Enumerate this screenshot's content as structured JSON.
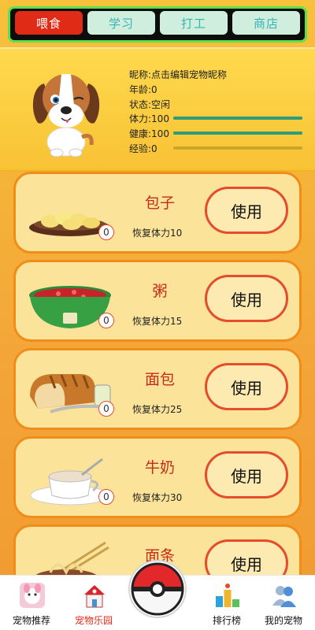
{
  "tabs": [
    {
      "label": "喂食",
      "active": true
    },
    {
      "label": "学习",
      "active": false
    },
    {
      "label": "打工",
      "active": false
    },
    {
      "label": "商店",
      "active": false
    }
  ],
  "pet": {
    "nickname_label": "昵称:点击编辑宠物昵称",
    "age_label": "年龄:0",
    "status_label": "状态:空闲",
    "stamina_label": "体力:100",
    "health_label": "健康:100",
    "exp_label": "经验:0",
    "stamina_fraction": 1.0,
    "health_fraction": 1.0,
    "exp_fraction": 0.0,
    "image": "beagle-puppy-icon"
  },
  "foods": [
    {
      "name": "包子",
      "desc": "恢复体力10",
      "count": "0",
      "button": "使用",
      "icon": "buns-icon"
    },
    {
      "name": "粥",
      "desc": "恢复体力15",
      "count": "0",
      "button": "使用",
      "icon": "porridge-bowl-icon"
    },
    {
      "name": "面包",
      "desc": "恢复体力25",
      "count": "0",
      "button": "使用",
      "icon": "bread-icon"
    },
    {
      "name": "牛奶",
      "desc": "恢复体力30",
      "count": "0",
      "button": "使用",
      "icon": "milk-cup-icon"
    },
    {
      "name": "面条",
      "desc": "",
      "count": "",
      "button": "使用",
      "icon": "noodles-icon"
    }
  ],
  "nav": [
    {
      "label": "宠物推荐",
      "icon": "pet-recommend-icon",
      "active": false
    },
    {
      "label": "宠物乐园",
      "icon": "pet-park-icon",
      "active": true
    },
    {
      "label": "",
      "icon": "pokeball-icon",
      "active": false
    },
    {
      "label": "排行榜",
      "icon": "leaderboard-icon",
      "active": false
    },
    {
      "label": "我的宠物",
      "icon": "my-pets-icon",
      "active": false
    }
  ],
  "colors": {
    "active_tab": "#e02b17",
    "tab_text": "#38b3b3",
    "card_border": "#f08d1a",
    "bar_fill": "#2e9c79"
  }
}
